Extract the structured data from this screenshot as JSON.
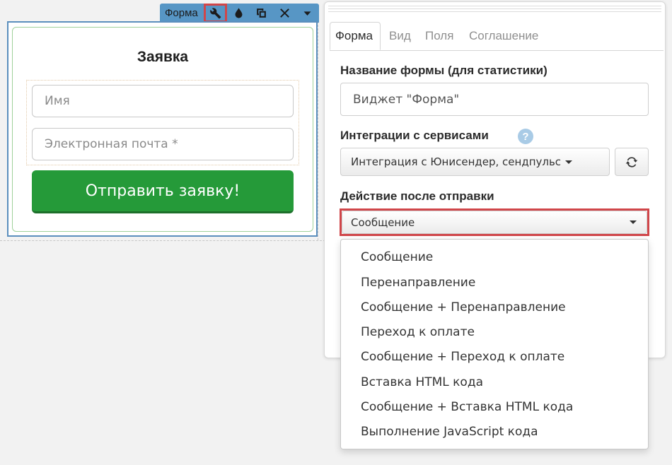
{
  "toolbar": {
    "label": "Форма",
    "icons": [
      "wrench-icon",
      "drop-icon",
      "copy-icon",
      "close-icon",
      "caret-down-icon"
    ],
    "active_icon": "wrench-icon",
    "highlight_color": "#d0464a",
    "bg_color": "#5796c5"
  },
  "form_widget": {
    "title": "Заявка",
    "name_placeholder": "Имя",
    "email_placeholder": "Электронная почта *",
    "submit_label": "Отправить заявку!",
    "submit_color": "#259a39"
  },
  "panel": {
    "tabs": [
      {
        "label": "Форма",
        "active": true
      },
      {
        "label": "Вид",
        "active": false
      },
      {
        "label": "Поля",
        "active": false
      },
      {
        "label": "Соглашение",
        "active": false
      }
    ],
    "form_name_label": "Название формы (для статистики)",
    "form_name_value": "Виджет \"Форма\"",
    "integrations_label": "Интеграции с сервисами",
    "help_symbol": "?",
    "integrations_value": "Интеграция с Юнисендер, сендпульс",
    "refresh_icon": "refresh-icon",
    "after_submit_label": "Действие после отправки",
    "after_submit_value": "Сообщение",
    "after_submit_options": [
      "Сообщение",
      "Перенаправление",
      "Сообщение + Перенаправление",
      "Переход к оплате",
      "Сообщение + Переход к оплате",
      "Вставка HTML кода",
      "Сообщение + Вставка HTML кода",
      "Выполнение JavaScript кода"
    ]
  }
}
